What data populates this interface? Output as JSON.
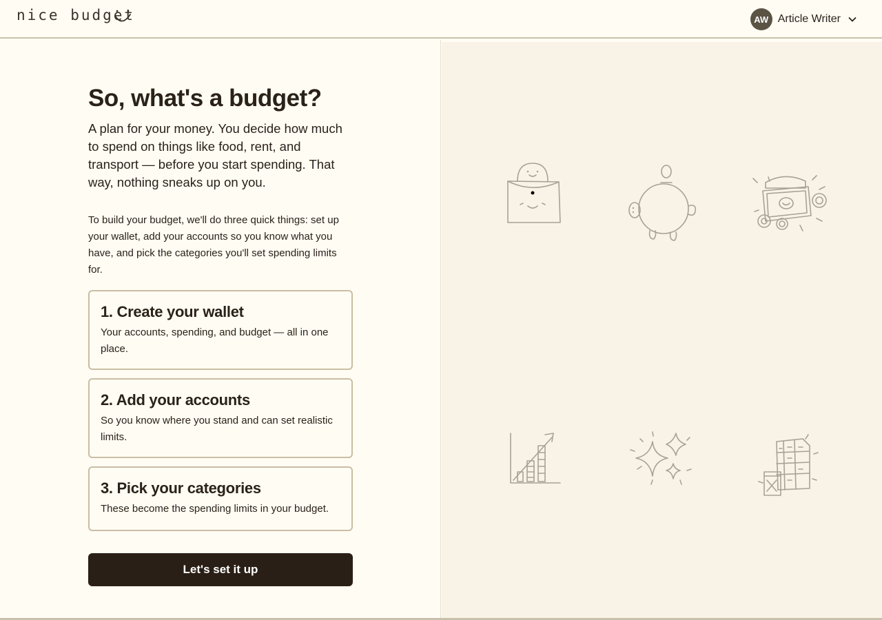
{
  "header": {
    "logo_text": "nice budget",
    "user": {
      "initials": "AW",
      "name": "Article Writer"
    }
  },
  "main": {
    "title": "So, what's a budget?",
    "lead": "A plan for your money. You decide how much to spend on things like food, rent, and transport — before you start spending. That way, nothing sneaks up on you.",
    "intro": "To build your budget, we'll do three quick things: set up your wallet, add your accounts so you know what you have, and pick the categories you'll set spending limits for.",
    "steps": [
      {
        "title": "1. Create your wallet",
        "desc": "Your accounts, spending, and budget — all in one place."
      },
      {
        "title": "2. Add your accounts",
        "desc": "So you know where you stand and can set realistic limits."
      },
      {
        "title": "3. Pick your categories",
        "desc": "These become the spending limits in your budget."
      }
    ],
    "cta_label": "Let's set it up"
  },
  "illustrations": [
    "wallet-icon",
    "piggy-bank-icon",
    "cash-coins-icon",
    "growth-chart-icon",
    "sparkles-icon",
    "spreadsheet-icon"
  ],
  "colors": {
    "background": "#fffcf4",
    "panel": "#f9f2e6",
    "button": "#2a1f16",
    "border": "#c9bea3",
    "sketch": "#a8a196",
    "avatar": "#5b5445"
  }
}
